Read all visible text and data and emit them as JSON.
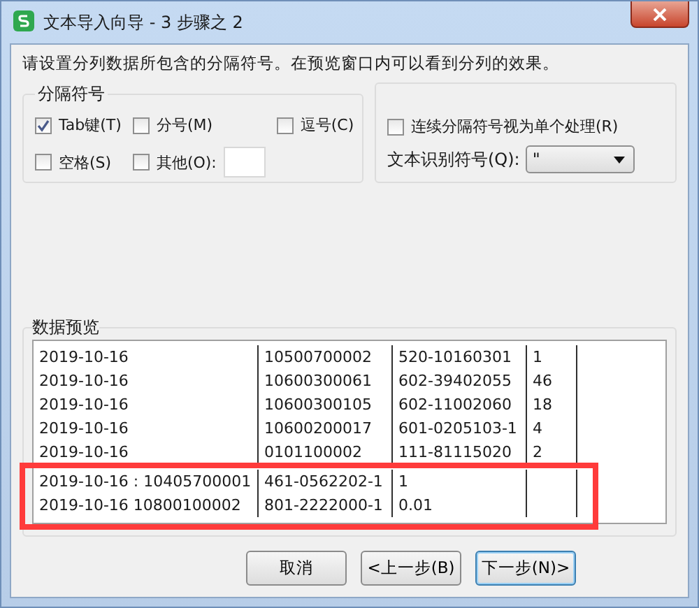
{
  "window": {
    "title": "文本导入向导 - 3 步骤之 2"
  },
  "instruction": "请设置分列数据所包含的分隔符号。在预览窗口内可以看到分列的效果。",
  "delimiters": {
    "title": "分隔符号",
    "options": [
      {
        "label": "Tab键(T)",
        "checked": true
      },
      {
        "label": "分号(M)",
        "checked": false
      },
      {
        "label": "逗号(C)",
        "checked": false
      },
      {
        "label": "空格(S)",
        "checked": false
      },
      {
        "label": "其他(O):",
        "checked": false,
        "kind": "other"
      }
    ]
  },
  "options": {
    "treat_consecutive": {
      "label": "连续分隔符号视为单个处理(R)",
      "checked": false
    },
    "qualifier": {
      "label": "文本识别符号(Q):",
      "value": "\""
    }
  },
  "preview": {
    "title": "数据预览",
    "rows": [
      {
        "cells": [
          "2019-10-16",
          "10500700002",
          "520-10160301",
          "1"
        ],
        "highlighted": false
      },
      {
        "cells": [
          "2019-10-16",
          "10600300061",
          "602-39402055",
          "46"
        ],
        "highlighted": false
      },
      {
        "cells": [
          "2019-10-16",
          "10600300105",
          "602-11002060",
          "18"
        ],
        "highlighted": false
      },
      {
        "cells": [
          "2019-10-16",
          "10600200017",
          "601-0205103-1",
          "4"
        ],
        "highlighted": false
      },
      {
        "cells": [
          "2019-10-16",
          "0101100002",
          "111-81115020",
          "2"
        ],
        "highlighted": false
      },
      {
        "cells": [
          "2019-10-16 : 10405700001",
          "461-0562202-1",
          "1",
          ""
        ],
        "highlighted": true
      },
      {
        "cells": [
          "2019-10-16 10800100002",
          "801-2222000-1",
          "0.01",
          ""
        ],
        "highlighted": true
      }
    ]
  },
  "buttons": [
    {
      "label": "取消",
      "focused": false
    },
    {
      "label": "<上一步(B)",
      "focused": false
    },
    {
      "label": "下一步(N)>",
      "focused": true
    }
  ]
}
